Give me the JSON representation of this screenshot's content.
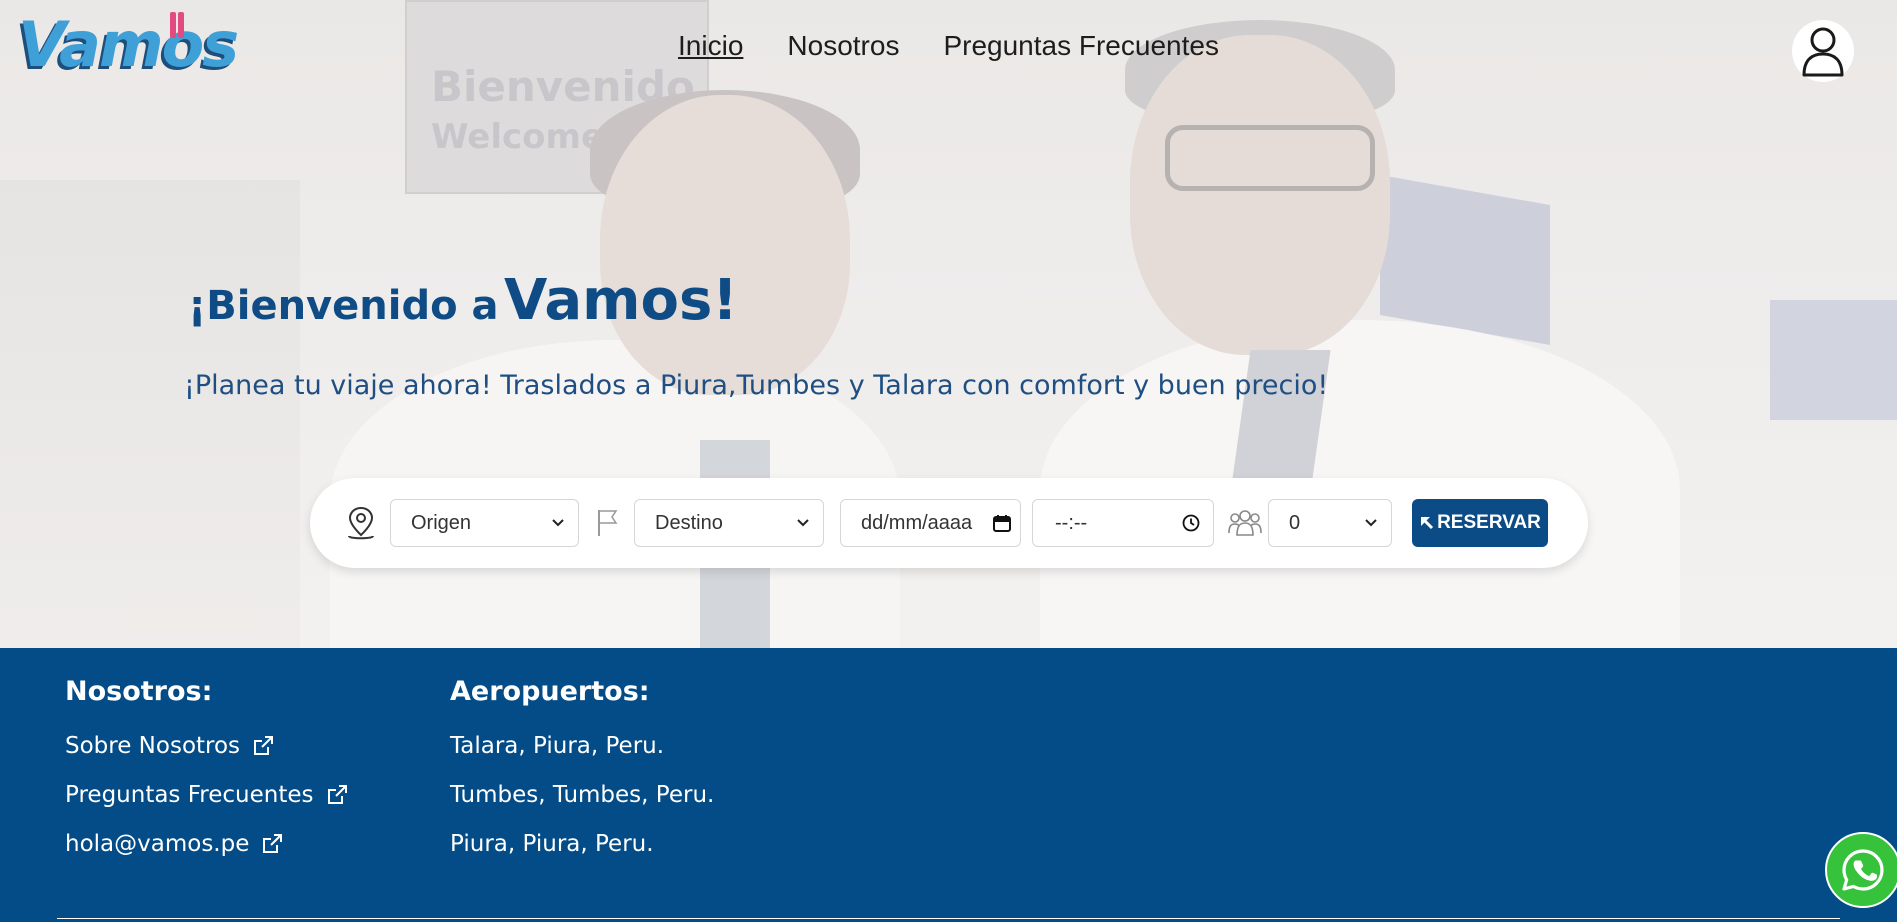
{
  "header": {
    "logo_text": "Vamos",
    "nav": [
      {
        "label": "Inicio",
        "active": true
      },
      {
        "label": "Nosotros",
        "active": false
      },
      {
        "label": "Preguntas Frecuentes",
        "active": false
      }
    ],
    "user_icon": "user-icon"
  },
  "hero": {
    "title_prefix": "¡Bienvenido a",
    "title_brand": "Vamos!",
    "subtitle": "¡Planea tu viaje ahora! Traslados a Piura,Tumbes y Talara con comfort y buen precio!",
    "background_sign_line1": "Bienvenido",
    "background_sign_line2": "Welcome"
  },
  "booking": {
    "origin_icon": "map-pin-icon",
    "origin_value": "Origen",
    "destination_icon": "flag-icon",
    "destination_value": "Destino",
    "date_placeholder": "dd/mm/aaaa",
    "time_placeholder": "--:--",
    "passengers_icon": "group-icon",
    "passengers_value": "0",
    "reserve_label": "RESERVAR"
  },
  "footer": {
    "about_heading": "Nosotros:",
    "about_links": [
      "Sobre Nosotros",
      "Preguntas Frecuentes",
      "hola@vamos.pe"
    ],
    "airports_heading": "Aeropuertos:",
    "airports": [
      "Talara, Piura, Peru.",
      "Tumbes, Tumbes, Peru.",
      "Piura, Piura, Peru."
    ]
  },
  "colors": {
    "brand_blue": "#044c87",
    "button_blue": "#0b4c87",
    "whatsapp_green": "#36c23b"
  }
}
